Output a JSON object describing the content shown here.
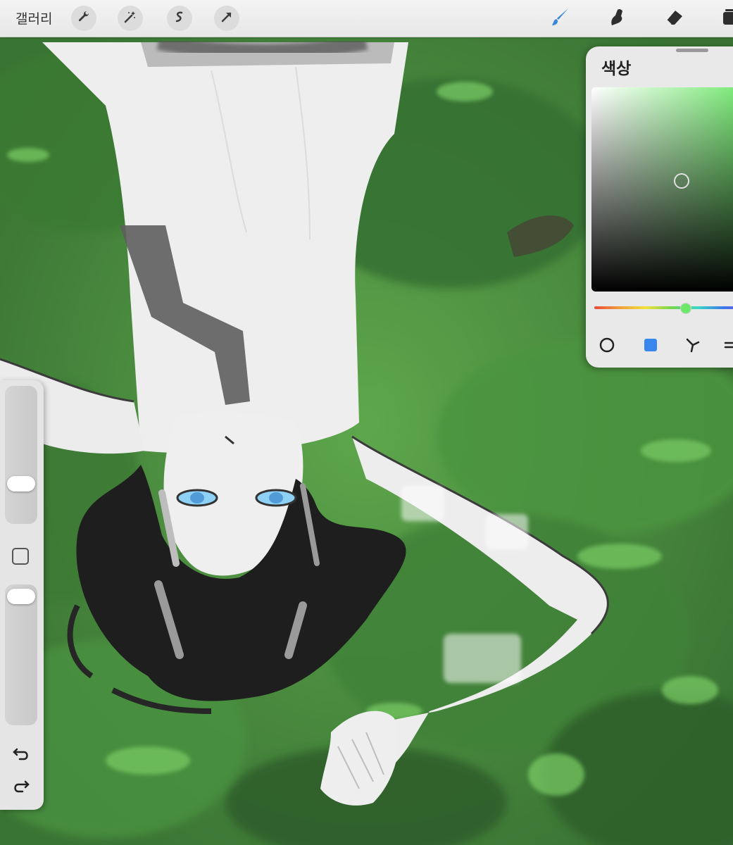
{
  "toolbar": {
    "gallery_label": "갤러리",
    "left_tools": [
      "wrench-icon",
      "magic-wand-icon",
      "selection-icon",
      "transform-arrow-icon"
    ],
    "right_tools": [
      "brush-icon",
      "smudge-icon",
      "eraser-icon",
      "layers-icon"
    ],
    "active_tool": "brush-icon",
    "active_color": "#3a86d8"
  },
  "color_panel": {
    "title": "색상",
    "current_hue_color": "#6ee86a",
    "modes": [
      "disc-icon",
      "square-icon",
      "harmony-icon",
      "value-icon"
    ],
    "active_mode": "square-icon",
    "active_mode_color": "#3a86ef"
  },
  "sidebar": {
    "brush_size_level": 0.2,
    "opacity_level": 0.85,
    "actions": [
      "undo-icon",
      "redo-icon"
    ]
  },
  "colors": {
    "grass": "#4b8c3f",
    "grass_dark": "#2f5f2a",
    "grass_light": "#7cd06a",
    "figure": "#ededed",
    "hair": "#1e1e1e",
    "eyes": "#8fd0f5"
  }
}
